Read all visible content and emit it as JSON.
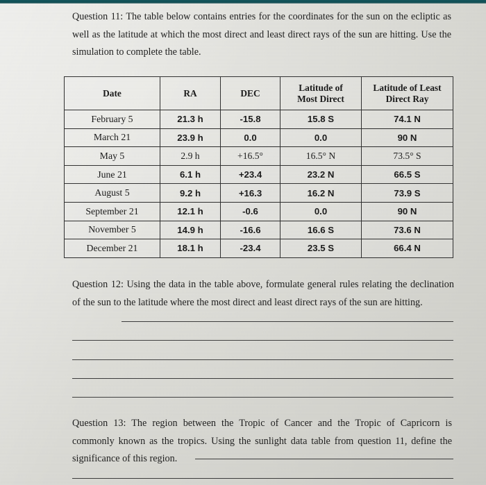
{
  "document": {
    "type": "worksheet-scan",
    "paper_color": "#d9d9d3",
    "top_strip_color": "#0a4b52"
  },
  "questions": {
    "q11": {
      "label": "Question 11:",
      "text": "Question 11: The table below contains entries for the coordinates for the sun on the ecliptic as well as the latitude at which the most direct and least direct rays of the sun are hitting. Use the simulation to complete the table."
    },
    "q12": {
      "label": "Question 12:",
      "text": "Question 12: Using the data in the table above, formulate general rules relating the declination of the sun to the latitude where the most direct and least direct rays of the sun are hitting.",
      "answer_lines": 5,
      "answer_value": ""
    },
    "q13": {
      "label": "Question 13:",
      "text": "Question 13: The region between the Tropic of Cancer and the Tropic of Capricorn is commonly known as the tropics. Using the sunlight data table from question 11, define the significance of this region.",
      "answer_lines": 2,
      "answer_value": ""
    }
  },
  "table": {
    "headers": [
      "Date",
      "RA",
      "DEC",
      "Latitude of Most Direct",
      "Latitude of Least Direct Ray"
    ],
    "header_lines": [
      [
        "Date"
      ],
      [
        "RA"
      ],
      [
        "DEC"
      ],
      [
        "Latitude of",
        "Most Direct"
      ],
      [
        "Latitude of Least",
        "Direct Ray"
      ]
    ],
    "rows": [
      {
        "date": "February 5",
        "ra": "21.3 h",
        "dec": "-15.8",
        "most_direct": "15.8 S",
        "least_direct": "74.1 N",
        "style": "filled"
      },
      {
        "date": "March 21",
        "ra": "23.9 h",
        "dec": "0.0",
        "most_direct": "0.0",
        "least_direct": "90 N",
        "style": "filled"
      },
      {
        "date": "May 5",
        "ra": "2.9 h",
        "dec": "+16.5°",
        "most_direct": "16.5° N",
        "least_direct": "73.5° S",
        "style": "serif"
      },
      {
        "date": "June 21",
        "ra": "6.1 h",
        "dec": "+23.4",
        "most_direct": "23.2 N",
        "least_direct": "66.5 S",
        "style": "filled"
      },
      {
        "date": "August 5",
        "ra": "9.2 h",
        "dec": "+16.3",
        "most_direct": "16.2 N",
        "least_direct": "73.9 S",
        "style": "filled"
      },
      {
        "date": "September 21",
        "ra": "12.1 h",
        "dec": "-0.6",
        "most_direct": "0.0",
        "least_direct": "90 N",
        "style": "filled"
      },
      {
        "date": "November 5",
        "ra": "14.9 h",
        "dec": "-16.6",
        "most_direct": "16.6 S",
        "least_direct": "73.6 N",
        "style": "filled"
      },
      {
        "date": "December 21",
        "ra": "18.1 h",
        "dec": "-23.4",
        "most_direct": "23.5 S",
        "least_direct": "66.4 N",
        "style": "filled"
      }
    ]
  }
}
